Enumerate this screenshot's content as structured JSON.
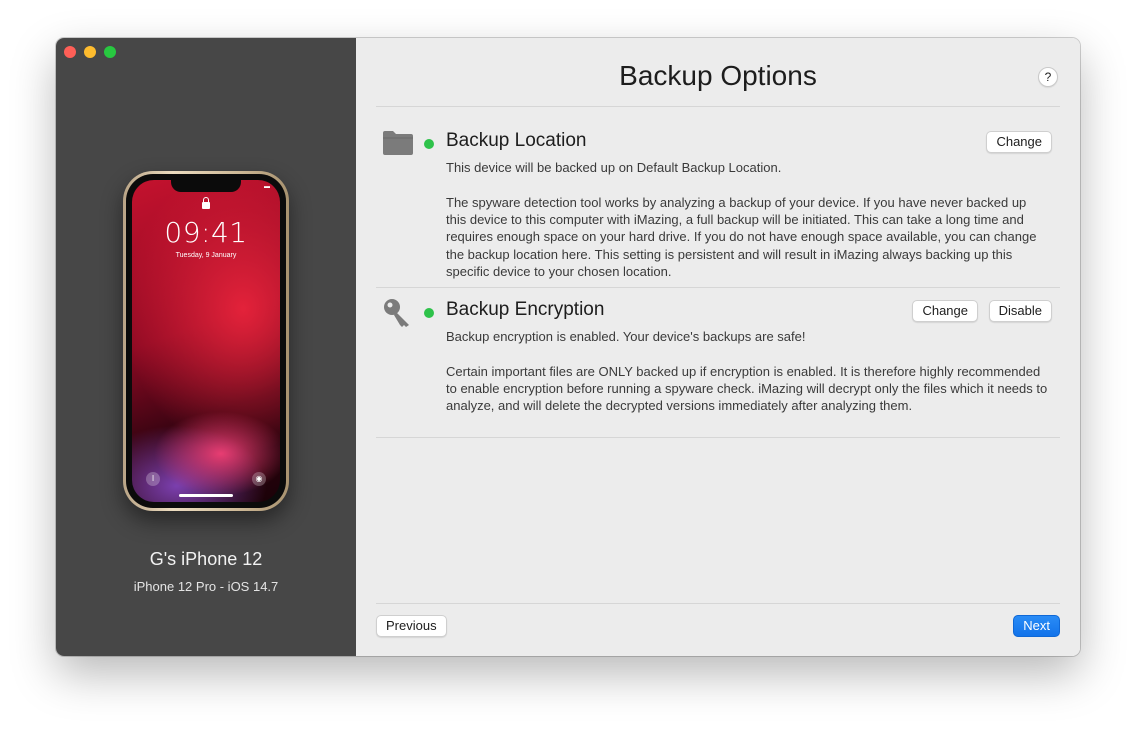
{
  "window": {
    "traffic_lights": [
      "close",
      "minimize",
      "zoom"
    ]
  },
  "sidebar": {
    "phone": {
      "time": "09:41",
      "date": "Tuesday, 9 January",
      "wallpaper_colors": [
        "#c4122e",
        "#e3223a",
        "#7b3fae"
      ]
    },
    "device_name": "G's iPhone 12",
    "device_model": "iPhone 12 Pro - iOS 14.7"
  },
  "main": {
    "title": "Backup Options",
    "help_label": "?",
    "sections": [
      {
        "icon": "folder-icon",
        "status": "green",
        "title": "Backup Location",
        "subtitle": "This device will be backed up on Default Backup Location.",
        "body": "The spyware detection tool works by analyzing a backup of your device. If you have never backed up this device to this computer with iMazing, a full backup will be initiated.  This can take a long time and requires enough space on your hard drive. If you do not have enough space available, you can change the backup location here. This setting is persistent and will result in iMazing always backing up this specific device to your chosen location.",
        "buttons": [
          "Change"
        ]
      },
      {
        "icon": "key-icon",
        "status": "green",
        "title": "Backup Encryption",
        "subtitle": "Backup encryption is enabled. Your device's backups are safe!",
        "body": "Certain important files are ONLY backed up if encryption is enabled. It is therefore highly recommended to enable encryption before running a spyware check. iMazing will decrypt only the files which it needs to analyze, and will delete the decrypted versions immediately after analyzing them.",
        "buttons": [
          "Change",
          "Disable"
        ]
      }
    ]
  },
  "footer": {
    "previous_label": "Previous",
    "next_label": "Next"
  },
  "colors": {
    "sidebar_bg": "#474747",
    "main_bg": "#ececec",
    "status_green": "#2ec24a",
    "accent_blue": "#1273ea"
  }
}
